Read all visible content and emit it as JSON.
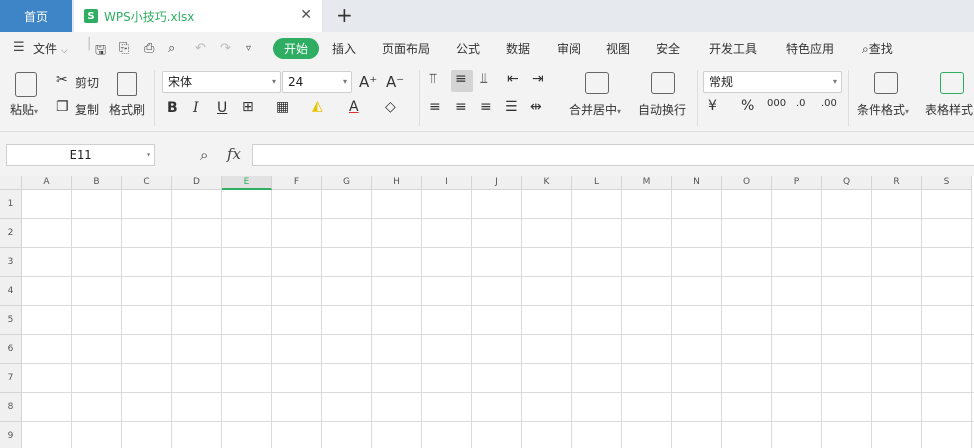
{
  "tabs": {
    "home_label": "首页",
    "file_name": "WPS小技巧.xlsx",
    "file_icon": "S",
    "close": "✕",
    "new_tab": "+"
  },
  "menu": {
    "file_label": "文件",
    "items": [
      "开始",
      "插入",
      "页面布局",
      "公式",
      "数据",
      "审阅",
      "视图",
      "安全",
      "开发工具",
      "特色应用"
    ],
    "active": "开始",
    "search_label": "查找"
  },
  "ribbon": {
    "paste": "粘贴",
    "cut": "剪切",
    "copy": "复制",
    "format_painter": "格式刷",
    "font_name": "宋体",
    "font_size": "24",
    "merge_center": "合并居中",
    "auto_wrap": "自动换行",
    "number_format": "常规",
    "conditional_format": "条件格式",
    "table_style": "表格样式",
    "percent": "%",
    "thousands": "000",
    "dec_increase": ".0",
    "dec_decrease": ".00"
  },
  "formula_bar": {
    "cell_ref": "E11",
    "fx": "fx",
    "value": ""
  },
  "grid": {
    "columns": [
      "A",
      "B",
      "C",
      "D",
      "E",
      "F",
      "G",
      "H",
      "I",
      "J",
      "K",
      "L",
      "M",
      "N",
      "O",
      "P",
      "Q",
      "R",
      "S"
    ],
    "rows": [
      "1",
      "2",
      "3",
      "4",
      "5",
      "6",
      "7",
      "8",
      "9"
    ],
    "selected_column": "E"
  },
  "colors": {
    "accent": "#2fae63",
    "home_tab": "#3d85c6"
  }
}
